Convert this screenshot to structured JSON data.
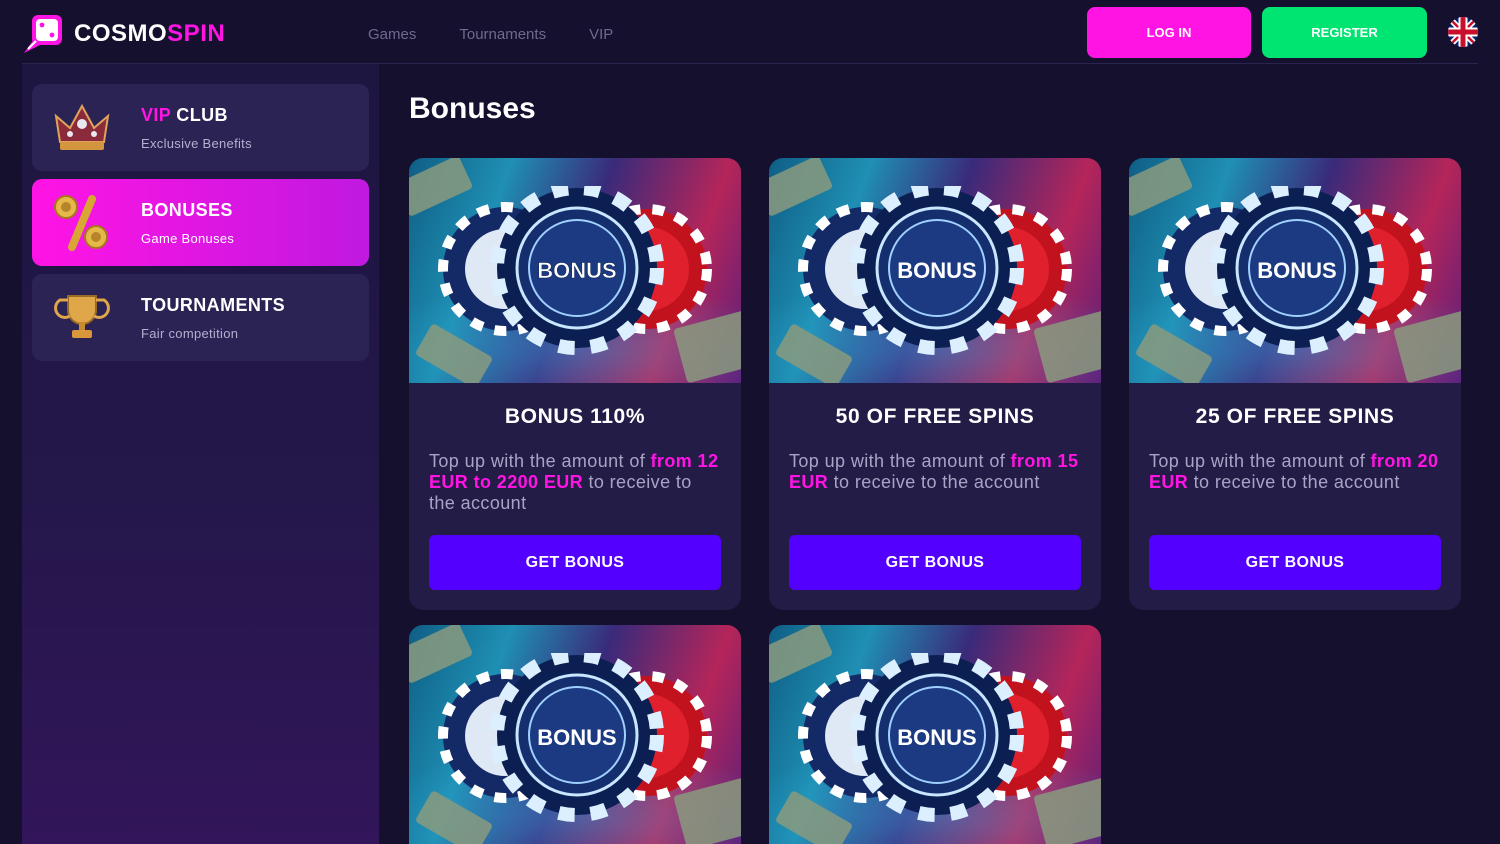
{
  "brand": {
    "name_part1": "COSMO",
    "name_part2": "SPIN"
  },
  "nav": [
    "Games",
    "Tournaments",
    "VIP"
  ],
  "auth": {
    "login": "LOG IN",
    "register": "REGISTER"
  },
  "language_flag": "uk-flag-icon",
  "sidebar": {
    "items": [
      {
        "title_accent": "VIP",
        "title_rest": " CLUB",
        "subtitle": "Exclusive Benefits",
        "icon": "crown-icon",
        "active": false
      },
      {
        "title_accent": "",
        "title_rest": "BONUSES",
        "subtitle": "Game Bonuses",
        "icon": "percent-coins-icon",
        "active": true
      },
      {
        "title_accent": "",
        "title_rest": "TOURNAMENTS",
        "subtitle": "Fair competition",
        "icon": "trophy-icon",
        "active": false
      }
    ]
  },
  "page_title": "Bonuses",
  "chip_label": "BONUS",
  "cards": [
    {
      "title": "BONUS 110%",
      "desc_pre": "Top up with the amount of ",
      "desc_hl": "from 12 EUR to 2200 EUR",
      "desc_post": " to receive to the account",
      "button": "GET BONUS"
    },
    {
      "title": "50 OF FREE SPINS",
      "desc_pre": "Top up with the amount of ",
      "desc_hl": "from 15 EUR",
      "desc_post": " to receive to the account",
      "button": "GET BONUS"
    },
    {
      "title": "25 OF FREE SPINS",
      "desc_pre": "Top up with the amount of ",
      "desc_hl": "from 20 EUR",
      "desc_post": " to receive to the account",
      "button": "GET BONUS"
    },
    {
      "title": "",
      "desc_pre": "",
      "desc_hl": "",
      "desc_post": "",
      "button": ""
    },
    {
      "title": "",
      "desc_pre": "",
      "desc_hl": "",
      "desc_post": "",
      "button": ""
    }
  ],
  "colors": {
    "accent_pink": "#ff14e4",
    "accent_green": "#00e571",
    "button_purple": "#5400ff",
    "background": "#15102e"
  }
}
